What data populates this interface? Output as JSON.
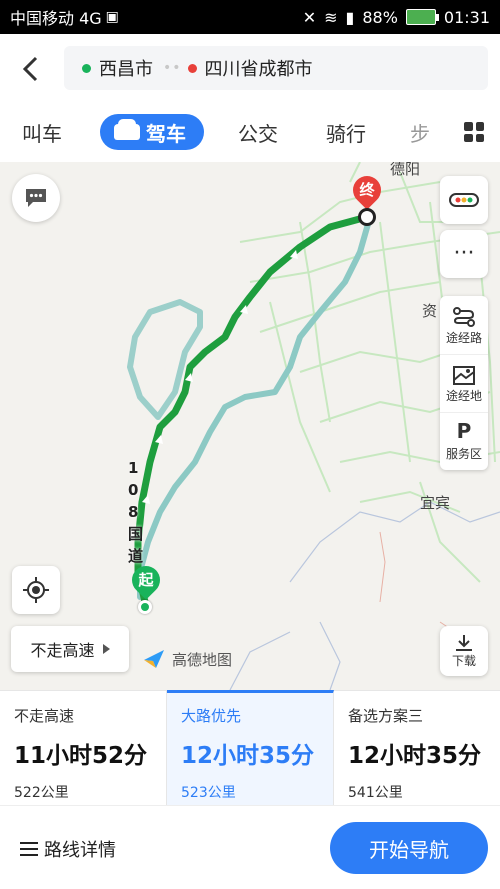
{
  "status_bar": {
    "carrier": "中国移动 4G",
    "battery": "88%",
    "time": "01:31"
  },
  "route": {
    "origin": "西昌市",
    "destination": "四川省成都市"
  },
  "tabs": [
    {
      "label": "叫车"
    },
    {
      "label": "驾车"
    },
    {
      "label": "公交"
    },
    {
      "label": "骑行"
    },
    {
      "label": "步"
    }
  ],
  "map": {
    "labels": {
      "deyang": "德阳",
      "zi": "资",
      "yibin": "宜宾",
      "road_108": "108国道"
    },
    "end_marker": "终",
    "start_marker": "起",
    "logo": "高德地图"
  },
  "side_tools": {
    "waypoint_route": "途经路",
    "waypoint_place": "途经地",
    "service_area": "服务区",
    "download": "下载"
  },
  "no_highway_button": "不走高速",
  "options": [
    {
      "label": "不走高速",
      "time": "11小时52分",
      "distance": "522公里"
    },
    {
      "label": "大路优先",
      "time": "12小时35分",
      "distance": "523公里"
    },
    {
      "label": "备选方案三",
      "time": "12小时35分",
      "distance": "541公里"
    }
  ],
  "bottom": {
    "details": "路线详情",
    "start_nav": "开始导航"
  },
  "colors": {
    "accent": "#2d7df6",
    "route_primary": "#1e9e3e",
    "route_alt": "#8cc9c4",
    "origin_dot": "#19b35b",
    "destination_dot": "#e8403a"
  }
}
